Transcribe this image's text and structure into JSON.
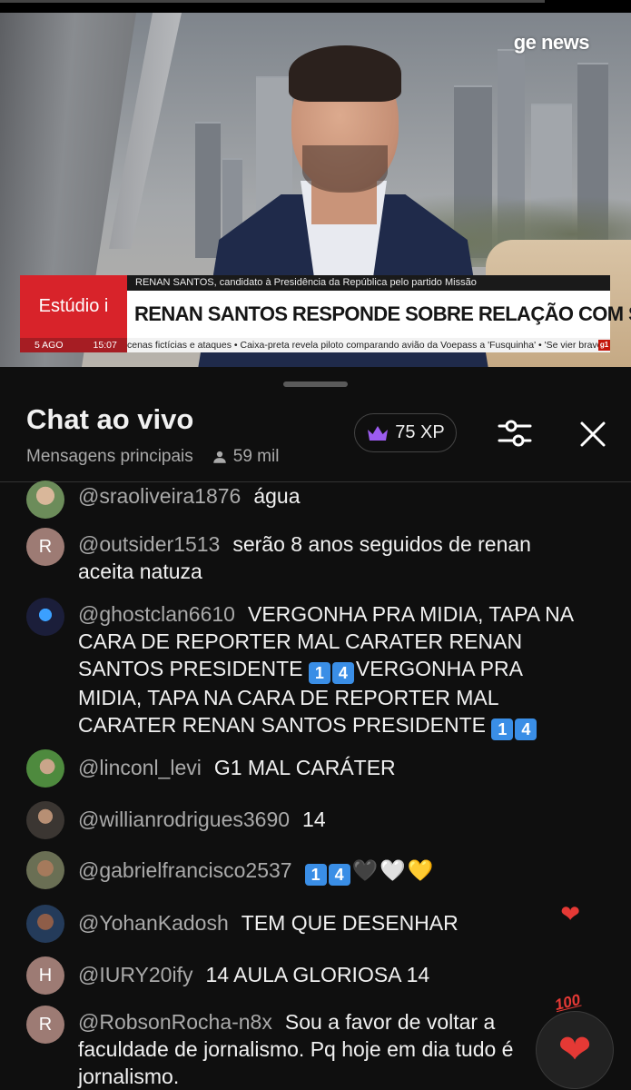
{
  "video": {
    "channel_logo": "ge news",
    "program": "Estúdio i",
    "caption_top": "RENAN SANTOS, candidato à Presidência da República pelo partido Missão",
    "headline": "RENAN SANTOS RESPONDE SOBRE RELAÇÃO COM STF",
    "date": "5 AGO",
    "time": "15:07",
    "ticker": "cenas fictícias e ataques • Caixa-preta revela piloto comparando avião da Voepass a 'Fusquinha' • 'Se vier bravo",
    "ticker_badge": "g1",
    "accent_color": "#d8232a"
  },
  "panel": {
    "title": "Chat ao vivo",
    "mode": "Mensagens principais",
    "viewers": "59 mil",
    "xp": "75 XP",
    "icons": {
      "xp": "crown-icon",
      "filter": "sliders-icon",
      "close": "close-icon",
      "viewers": "person-icon"
    }
  },
  "messages": [
    {
      "author": "@sraoliveira1876",
      "text": "água",
      "avatar": "photo"
    },
    {
      "author": "@outsider1513",
      "text": "serão 8 anos seguidos de renan aceita natuza",
      "avatar_letter": "R"
    },
    {
      "author": "@ghostclan6610",
      "text_a": "VERGONHA PRA MIDIA, TAPA NA CARA DE REPORTER MAL CARATER RENAN SANTOS PRESIDENTE ",
      "text_b": "VERGONHA PRA MIDIA, TAPA NA CARA DE REPORTER MAL CARATER RENAN SANTOS PRESIDENTE ",
      "avatar": "photo"
    },
    {
      "author": "@linconl_levi",
      "text": "G1 MAL CARÁTER",
      "avatar": "photo"
    },
    {
      "author": "@willianrodrigues3690",
      "text": "14",
      "avatar": "photo"
    },
    {
      "author": "@gabrielfrancisco2537",
      "hearts": "🖤🤍💛",
      "avatar": "photo"
    },
    {
      "author": "@YohanKadosh",
      "text": "TEM QUE DESENHAR",
      "avatar": "photo"
    },
    {
      "author": "@IURY20ify",
      "text": "14 AULA GLORIOSA 14",
      "avatar_letter": "H"
    },
    {
      "author": "@RobsonRocha-n8x",
      "text": "Sou a favor de voltar a faculdade de jornalismo. Pq hoje em dia tudo é jornalismo.",
      "avatar_letter": "R"
    }
  ],
  "emoji_keycaps": {
    "one": "1",
    "four": "4"
  },
  "reaction": {
    "badge": "100",
    "heart": "❤"
  },
  "side_reaction": "❤"
}
